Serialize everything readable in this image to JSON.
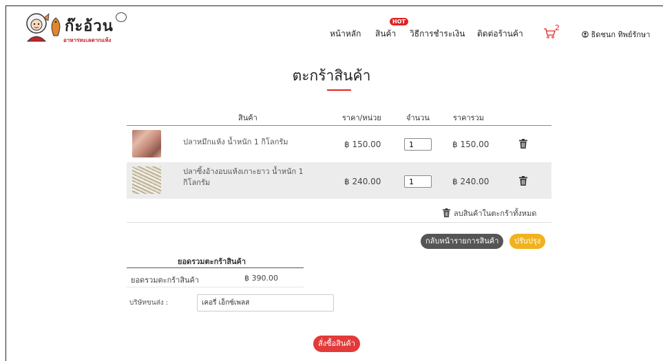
{
  "brand": {
    "name": "ก๊ะอ้วน",
    "tagline": "อาหารทะเลตากแห้ง"
  },
  "nav": {
    "home": "หน้าหลัก",
    "products": "สินค้า",
    "products_badge": "HOT",
    "payment": "วิธีการชำระเงิน",
    "contact": "ติดต่อร้านค้า",
    "cart_count": "2",
    "user_name": "ธิดชนก ทิพย์รักษา"
  },
  "page": {
    "title": "ตะกร้าสินค้า"
  },
  "table": {
    "headers": {
      "product": "สินค้า",
      "unit_price": "ราคา/หน่วย",
      "quantity": "จำนวน",
      "total": "ราคารวม"
    },
    "rows": [
      {
        "name": "ปลาหมึกแห้ง น้ำหนัก 1 กิโลกรัม",
        "unit_price": "฿ 150.00",
        "quantity": "1",
        "total": "฿ 150.00"
      },
      {
        "name": "ปลาซิ้งอ้างอบแห้งเกาะยาว น้ำหนัก 1 กิโลกรัม",
        "unit_price": "฿ 240.00",
        "quantity": "1",
        "total": "฿ 240.00"
      }
    ],
    "clear_all": "ลบสินค้าในตะกร้าทั้งหมด"
  },
  "actions": {
    "back": "กลับหน้ารายการสินค้า",
    "update": "ปรับปรุง",
    "order": "สั่งซื้อสินค้า"
  },
  "summary": {
    "title": "ยอดรวมตะกร้าสินค้า",
    "label": "ยอดรวมตะกร้าสินค้า",
    "value": "฿ 390.00"
  },
  "shipping": {
    "label": "บริษัทขนส่ง :",
    "value": "เคอรี่ เอ็กซ์เพลส"
  },
  "colors": {
    "accent_red": "#e02424",
    "update_yellow": "#f0b21e",
    "back_gray": "#555555"
  }
}
